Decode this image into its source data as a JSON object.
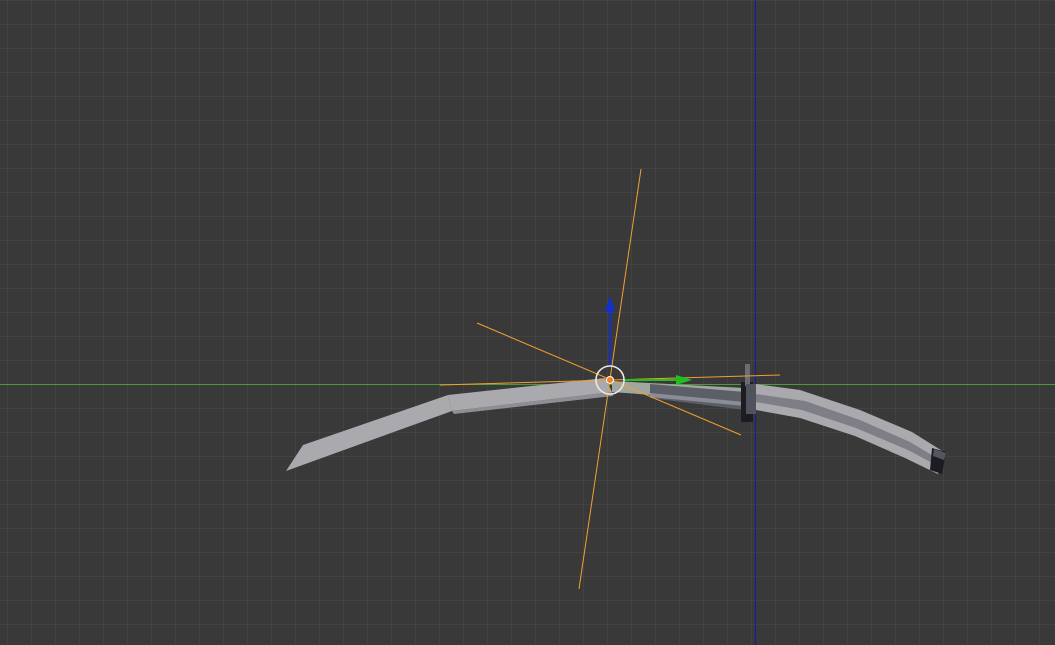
{
  "viewport": {
    "background_color": "#393939",
    "grid_visible": true
  },
  "axes": {
    "x_axis_color": "#4a9a3a",
    "z_axis_color": "#1a1a9a"
  },
  "object": {
    "name_shown": "",
    "selected": true,
    "blade_color": "#a9a9ae",
    "handle_color": "#7d7e86",
    "guard_color": "#1c1c22",
    "selection_outline_color": "#f0a030"
  },
  "gizmo": {
    "type": "translate",
    "z_arrow_color": "#1030d0",
    "y_arrow_color": "#20c020",
    "center_ring_color": "#e8e8e8",
    "origin_color": "#f08020"
  },
  "empty_axes_color": "#f0a030"
}
